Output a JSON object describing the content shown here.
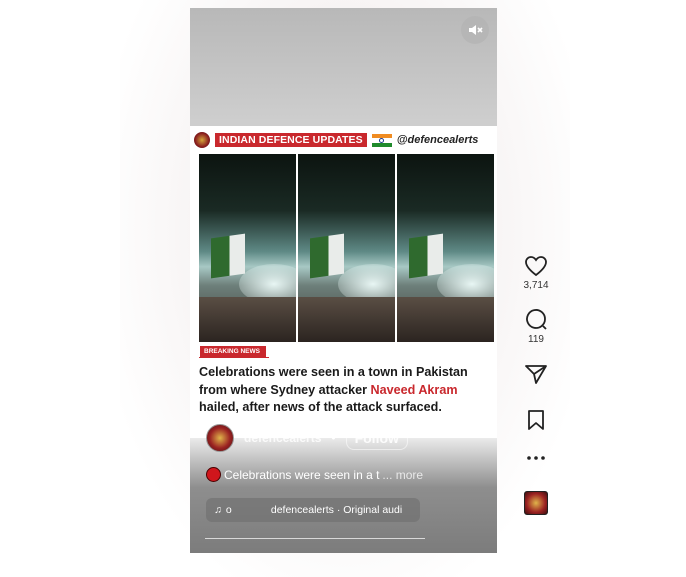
{
  "reel": {
    "header_banner": "INDIAN DEFENCE UPDATES",
    "header_handle": "@defencealerts",
    "breaking_tag": "BREAKING NEWS",
    "caption_part1": "Celebrations were seen in a town in Pakistan from where Sydney attacker ",
    "caption_highlight": "Naveed Akram",
    "caption_part2": " hailed, after news of the attack surfaced.",
    "author_username": "defencealerts",
    "author_separator": "•",
    "follow_label": "Follow",
    "description": "Celebrations were seen in a t",
    "description_more": "... more",
    "audio_count": "o",
    "audio_label": "defencealerts · Original audi",
    "mute_icon": "muted-speaker-icon"
  },
  "actions": {
    "like_count": "3,714",
    "comment_count": "119",
    "icons": [
      "heart-icon",
      "comment-icon",
      "share-icon",
      "bookmark-icon",
      "more-icon"
    ]
  },
  "colors": {
    "accent_red": "#c9282d",
    "text_dark": "#1a1a1a"
  }
}
